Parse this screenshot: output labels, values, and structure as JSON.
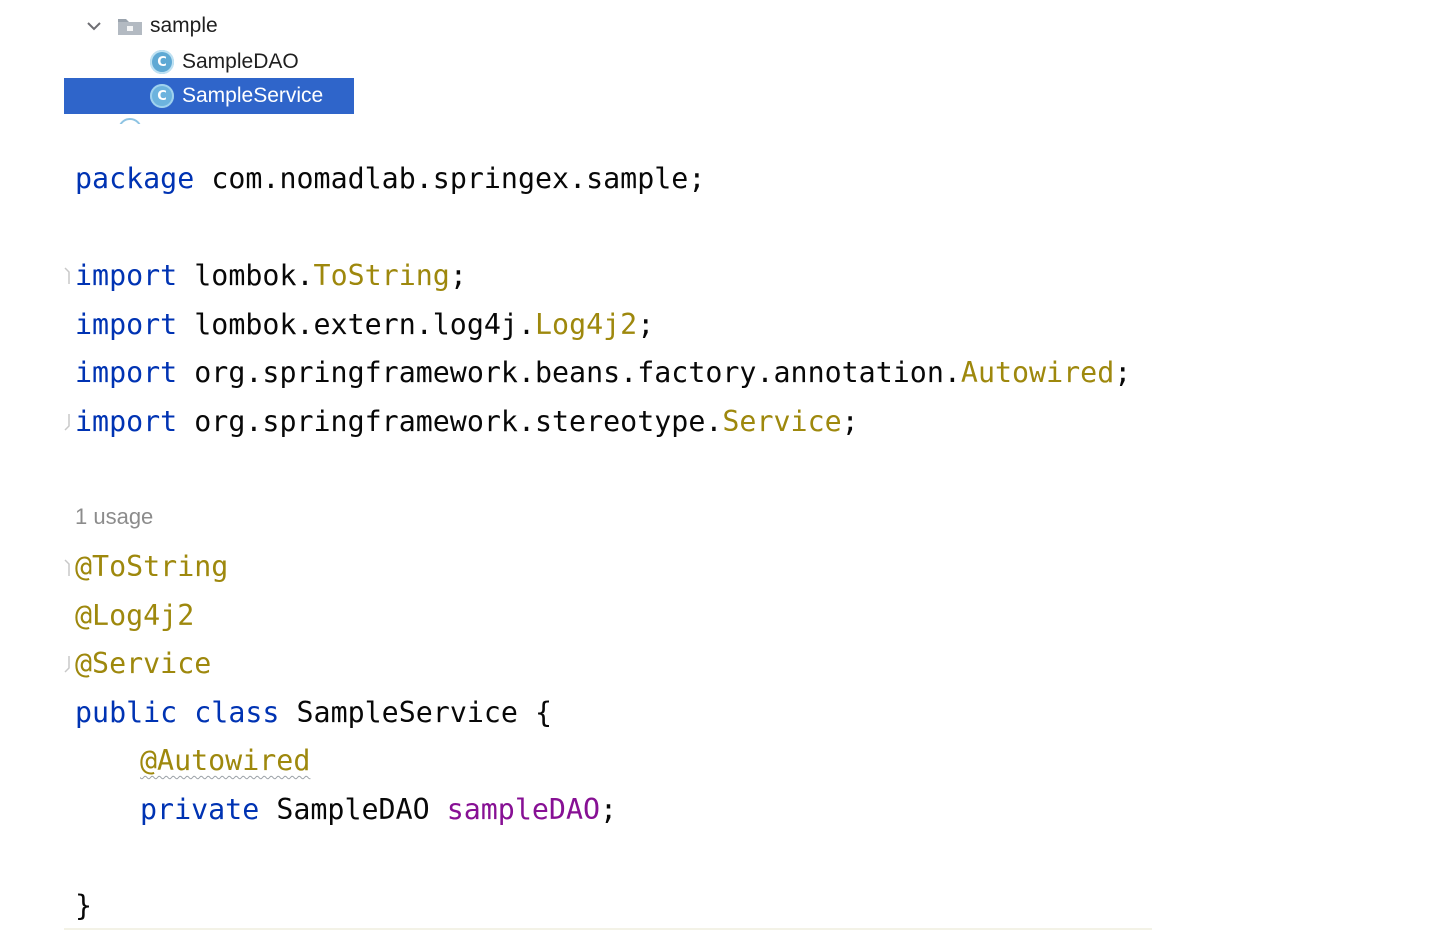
{
  "project_tree": {
    "folder": {
      "label": "sample",
      "expanded": true,
      "icon": "folder-icon"
    },
    "items": [
      {
        "label": "SampleDAO",
        "icon": "class-icon",
        "icon_glyph": "C",
        "selected": false
      },
      {
        "label": "SampleService",
        "icon": "class-icon",
        "icon_glyph": "C",
        "selected": true
      }
    ],
    "selection_color": "#2f65ca"
  },
  "editor": {
    "package_keyword": "package",
    "package_name": "com.nomadlab.springex.sample",
    "semicolon": ";",
    "imports": [
      {
        "keyword": "import",
        "path": "lombok.",
        "name": "ToString"
      },
      {
        "keyword": "import",
        "path": "lombok.extern.log4j.",
        "name": "Log4j2"
      },
      {
        "keyword": "import",
        "path": "org.springframework.beans.factory.annotation.",
        "name": "Autowired"
      },
      {
        "keyword": "import",
        "path": "org.springframework.stereotype.",
        "name": "Service"
      }
    ],
    "usage_hint": "1 usage",
    "annotations": [
      "@ToString",
      "@Log4j2",
      "@Service"
    ],
    "class_decl": {
      "modifier": "public",
      "keyword": "class",
      "name": "SampleService",
      "open_brace": "{"
    },
    "field_annotation": "@Autowired",
    "field": {
      "modifier": "private",
      "type": "SampleDAO",
      "name": "sampleDAO"
    },
    "close_brace": "}",
    "colors": {
      "keyword": "#0033b3",
      "annotation": "#9e880d",
      "field": "#871094",
      "text": "#080808",
      "hint": "#8c8c8c"
    }
  }
}
